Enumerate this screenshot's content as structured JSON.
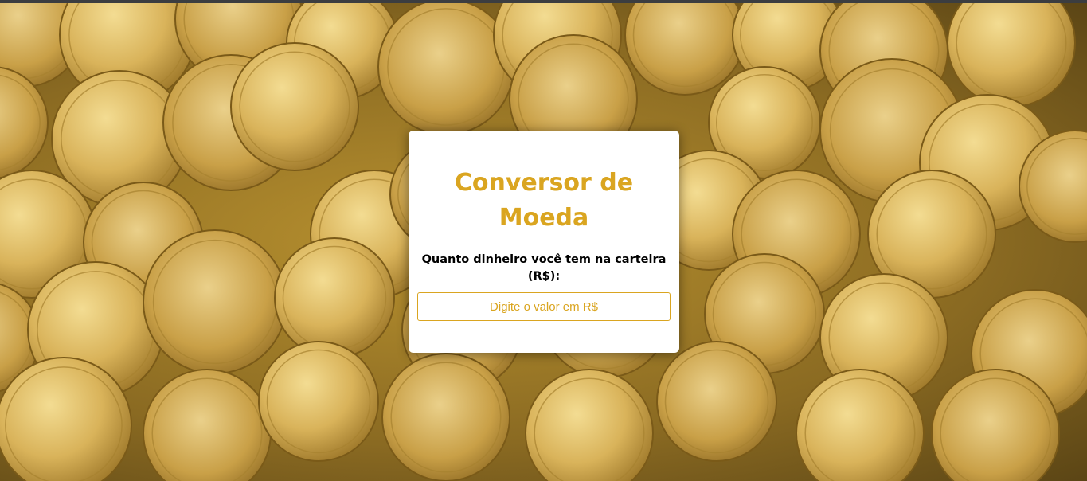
{
  "background": {
    "icon": "gold-coins-image"
  },
  "converter": {
    "title": "Conversor de Moeda",
    "amount_label": "Quanto dinheiro você tem na carteira (R$):",
    "amount_input": {
      "value": "",
      "placeholder": "Digite o valor em R$"
    }
  },
  "colors": {
    "accent": "#daa520",
    "card_background": "#ffffff",
    "label_text": "#000000"
  }
}
